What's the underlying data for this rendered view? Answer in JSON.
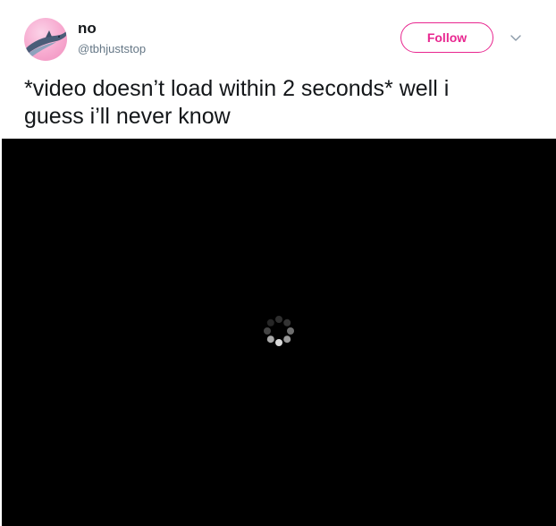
{
  "author": {
    "display_name": "no",
    "handle": "@tbhjuststop",
    "avatar_icon": "dolphin-avatar"
  },
  "follow": {
    "label": "Follow",
    "color": "#e8268f"
  },
  "menu": {
    "icon": "chevron-down-icon"
  },
  "tweet": {
    "line1": "*video doesn’t load within 2 seconds* well i",
    "line2": "guess i’ll never know"
  },
  "video": {
    "state": "loading",
    "spinner_icon": "loading-spinner-icon",
    "background": "#000000"
  }
}
